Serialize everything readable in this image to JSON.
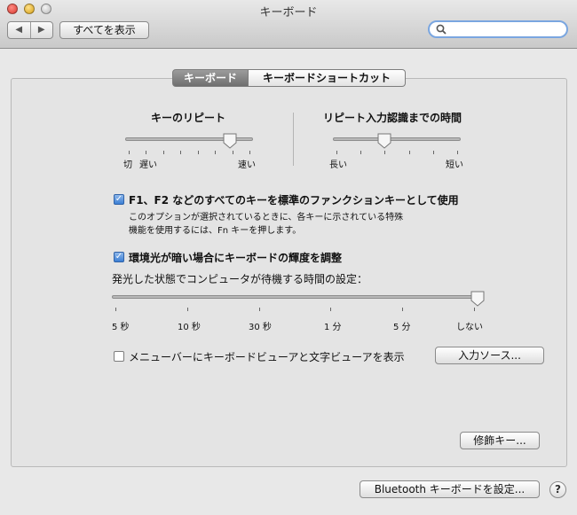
{
  "window": {
    "title": "キーボード"
  },
  "toolbar": {
    "back_icon": "◀",
    "forward_icon": "▶",
    "show_all_label": "すべてを表示",
    "search_placeholder": ""
  },
  "tabs": [
    {
      "label": "キーボード",
      "selected": true
    },
    {
      "label": "キーボードショートカット",
      "selected": false
    }
  ],
  "key_repeat": {
    "title": "キーのリピート",
    "label_off": "切",
    "label_slow": "遅い",
    "label_fast": "速い",
    "level": 0.82
  },
  "delay_until_repeat": {
    "title": "リピート入力認識までの時間",
    "label_long": "長い",
    "label_short": "短い",
    "level": 0.4
  },
  "fkeys": {
    "checked": true,
    "label": "F1、F2 などのすべてのキーを標準のファンクションキーとして使用",
    "description_line1": "このオプションが選択されているときに、各キーに示されている特殊",
    "description_line2": "機能を使用するには、Fn キーを押します。"
  },
  "backlight": {
    "checked": true,
    "label": "環境光が暗い場合にキーボードの輝度を調整",
    "idle_label": "発光した状態でコンピュータが待機する時間の設定：",
    "ticks": [
      "5 秒",
      "10 秒",
      "30 秒",
      "1 分",
      "5 分",
      "しない"
    ],
    "selected_index": 5
  },
  "viewer": {
    "checked": false,
    "label": "メニューバーにキーボードビューアと文字ビューアを表示",
    "input_sources_button": "入力ソース..."
  },
  "buttons": {
    "modifier_keys": "修飾キー...",
    "bluetooth": "Bluetooth キーボードを設定...",
    "help": "?"
  },
  "colors": {
    "accent": "#3c7fd5",
    "tab_selected": "#7f7f7f"
  }
}
